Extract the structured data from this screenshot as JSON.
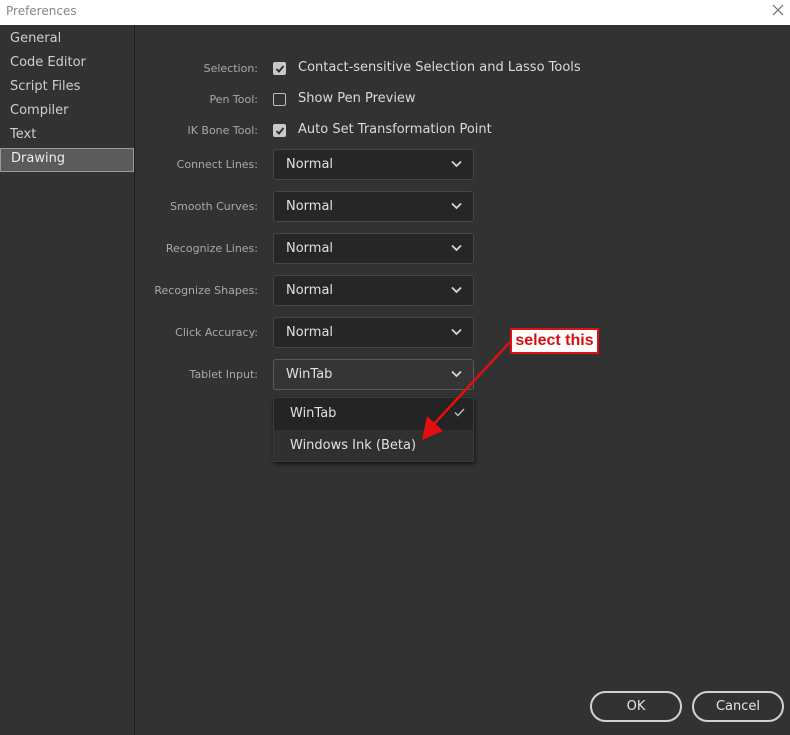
{
  "window": {
    "title": "Preferences"
  },
  "sidebar": {
    "items": [
      {
        "label": "General"
      },
      {
        "label": "Code Editor"
      },
      {
        "label": "Script Files"
      },
      {
        "label": "Compiler"
      },
      {
        "label": "Text"
      },
      {
        "label": "Drawing",
        "selected": true
      }
    ]
  },
  "drawing": {
    "selection": {
      "label": "Selection:",
      "checkbox_label": "Contact-sensitive Selection and Lasso Tools",
      "checked": true
    },
    "pen_tool": {
      "label": "Pen Tool:",
      "checkbox_label": "Show Pen Preview",
      "checked": false
    },
    "ik_bone": {
      "label": "IK Bone Tool:",
      "checkbox_label": "Auto Set Transformation Point",
      "checked": true
    },
    "connect_lines": {
      "label": "Connect Lines:",
      "value": "Normal"
    },
    "smooth_curves": {
      "label": "Smooth Curves:",
      "value": "Normal"
    },
    "recognize_lines": {
      "label": "Recognize Lines:",
      "value": "Normal"
    },
    "recognize_shapes": {
      "label": "Recognize Shapes:",
      "value": "Normal"
    },
    "click_accuracy": {
      "label": "Click Accuracy:",
      "value": "Normal"
    },
    "tablet_input": {
      "label": "Tablet Input:",
      "value": "WinTab",
      "options": [
        {
          "label": "WinTab",
          "checked": true
        },
        {
          "label": "Windows Ink (Beta)",
          "checked": false
        }
      ]
    }
  },
  "buttons": {
    "ok": "OK",
    "cancel": "Cancel"
  },
  "annotation": {
    "text": "select this",
    "color": "#e01010"
  },
  "colors": {
    "background": "#323232",
    "field": "#262626",
    "titlebar": "#ffffff"
  }
}
